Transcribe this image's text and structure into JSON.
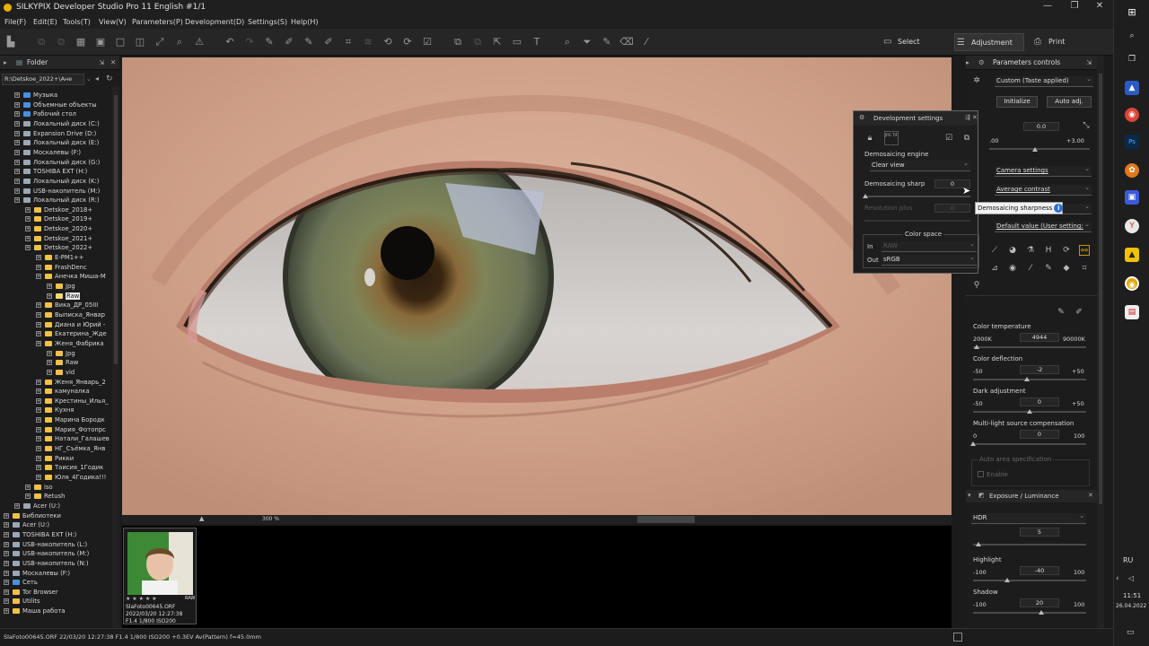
{
  "window": {
    "title": "SILKYPIX Developer Studio Pro 11 English  #1/1"
  },
  "menu": [
    "File(F)",
    "Edit(E)",
    "Tools(T)",
    "View(V)",
    "Parameters(P)",
    "Development(D)",
    "Settings(S)",
    "Help(H)"
  ],
  "modes": {
    "select": "Select",
    "adjustment": "Adjustment",
    "print": "Print"
  },
  "folder_panel": {
    "title": "Folder",
    "path": "R:\\Detskoe_2022+\\Ане",
    "items": [
      {
        "label": "Музыка",
        "indent": 1,
        "icon": "blue"
      },
      {
        "label": "Объемные объекты",
        "indent": 1,
        "icon": "blue"
      },
      {
        "label": "Рабочий стол",
        "indent": 1,
        "icon": "blue"
      },
      {
        "label": "Локальный диск (C:)",
        "indent": 1,
        "icon": "drv"
      },
      {
        "label": "Expansion Drive (D:)",
        "indent": 1,
        "icon": "drv"
      },
      {
        "label": "Локальный диск (E:)",
        "indent": 1,
        "icon": "drv"
      },
      {
        "label": "Москалевы (F:)",
        "indent": 1,
        "icon": "drv"
      },
      {
        "label": "Локальный диск (G:)",
        "indent": 1,
        "icon": "drv"
      },
      {
        "label": "TOSHIBA EXT (H:)",
        "indent": 1,
        "icon": "drv"
      },
      {
        "label": "Локальный диск (K:)",
        "indent": 1,
        "icon": "drv"
      },
      {
        "label": "USB-накопитель (M:)",
        "indent": 1,
        "icon": "drv"
      },
      {
        "label": "Локальный диск (R:)",
        "indent": 1,
        "icon": "drv"
      },
      {
        "label": "Detskoe_2018+",
        "indent": 2,
        "icon": "f"
      },
      {
        "label": "Detskoe_2019+",
        "indent": 2,
        "icon": "f"
      },
      {
        "label": "Detskoe_2020+",
        "indent": 2,
        "icon": "f"
      },
      {
        "label": "Detskoe_2021+",
        "indent": 2,
        "icon": "f"
      },
      {
        "label": "Detskoe_2022+",
        "indent": 2,
        "icon": "f"
      },
      {
        "label": "E-PM1++",
        "indent": 3,
        "icon": "f"
      },
      {
        "label": "FrashDenc",
        "indent": 3,
        "icon": "f"
      },
      {
        "label": "Анечка Миша-М",
        "indent": 3,
        "icon": "f"
      },
      {
        "label": "Jpg",
        "indent": 4,
        "icon": "f"
      },
      {
        "label": "Raw",
        "indent": 4,
        "icon": "sel",
        "selected": true
      },
      {
        "label": "Вика_ДР_05III",
        "indent": 3,
        "icon": "f"
      },
      {
        "label": "Выписка_Январ",
        "indent": 3,
        "icon": "f"
      },
      {
        "label": "Диана и Юрий -",
        "indent": 3,
        "icon": "f"
      },
      {
        "label": "Екатерина_Жде",
        "indent": 3,
        "icon": "f"
      },
      {
        "label": "Женя_Фабрика",
        "indent": 3,
        "icon": "f"
      },
      {
        "label": "Jpg",
        "indent": 4,
        "icon": "f"
      },
      {
        "label": "Raw",
        "indent": 4,
        "icon": "f"
      },
      {
        "label": "vid",
        "indent": 4,
        "icon": "f"
      },
      {
        "label": "Женя_Январь_2",
        "indent": 3,
        "icon": "f"
      },
      {
        "label": "камуналка",
        "indent": 3,
        "icon": "f"
      },
      {
        "label": "Крестины_Илья_",
        "indent": 3,
        "icon": "f"
      },
      {
        "label": "Кухня",
        "indent": 3,
        "icon": "f"
      },
      {
        "label": "Марина Бородк",
        "indent": 3,
        "icon": "f"
      },
      {
        "label": "Мария_Фотопрс",
        "indent": 3,
        "icon": "f"
      },
      {
        "label": "Натали_Галашев",
        "indent": 3,
        "icon": "f"
      },
      {
        "label": "НГ_Съёмка_Янв",
        "indent": 3,
        "icon": "f"
      },
      {
        "label": "Рикки",
        "indent": 3,
        "icon": "f"
      },
      {
        "label": "Таисия_1Годик",
        "indent": 3,
        "icon": "f"
      },
      {
        "label": "Юля_4Годика!!!",
        "indent": 3,
        "icon": "f"
      },
      {
        "label": "iso",
        "indent": 2,
        "icon": "f"
      },
      {
        "label": "Retush",
        "indent": 2,
        "icon": "f"
      },
      {
        "label": "Acer (U:)",
        "indent": 1,
        "icon": "drv"
      },
      {
        "label": "Библиотеки",
        "indent": 0,
        "icon": "f"
      },
      {
        "label": "Acer (U:)",
        "indent": 0,
        "icon": "drv"
      },
      {
        "label": "TOSHIBA EXT (H:)",
        "indent": 0,
        "icon": "drv"
      },
      {
        "label": "USB-накопитель (L:)",
        "indent": 0,
        "icon": "drv"
      },
      {
        "label": "USB-накопитель (M:)",
        "indent": 0,
        "icon": "drv"
      },
      {
        "label": "USB-накопитель (N:)",
        "indent": 0,
        "icon": "drv"
      },
      {
        "label": "Москалевы (F:)",
        "indent": 0,
        "icon": "drv"
      },
      {
        "label": "Сеть",
        "indent": 0,
        "icon": "blue"
      },
      {
        "label": "Tor Browser",
        "indent": 0,
        "icon": "f"
      },
      {
        "label": "Utilits",
        "indent": 0,
        "icon": "f"
      },
      {
        "label": "Маша работа",
        "indent": 0,
        "icon": "f"
      }
    ]
  },
  "viewer": {
    "zoom": "300 %"
  },
  "thumbnail": {
    "filename": "SlaFoto00645.ORF",
    "datetime": "2022/03/20 12:27:38",
    "exposure": "F1.4 1/800 ISO200",
    "badge": "RAW"
  },
  "status_text": "SlaFoto00645.ORF 22/03/20 12:27:38 F1.4 1/800 ISO200 +0.3EV Av(Pattern) f=45.0mm",
  "dev_dialog": {
    "title": "Development settings",
    "demosaicing_engine_label": "Demosaicing engine",
    "demosaicing_engine_value": "Clear view",
    "sharpness_label": "Demosaicing sharp",
    "sharpness_value": "0",
    "resolution_label": "Resolution plus",
    "resolution_value": "0",
    "color_space_label": "Color space",
    "in_label": "In",
    "in_value": "RAW",
    "out_label": "Out",
    "out_value": "sRGB",
    "tooltip": "Demosaicing sharpness"
  },
  "params_panel": {
    "title": "Parameters controls",
    "taste": "Custom (Taste applied)",
    "initialize": "Initialize",
    "auto_adj": "Auto adj.",
    "exposure_value": "0.0",
    "exposure_min": ".00",
    "exposure_max": "+3.00",
    "camera_settings": "Camera settings",
    "contrast": "Average contrast",
    "default_value": "Default value (User setting:",
    "color_temp": {
      "label": "Color temperature",
      "min": "2000K",
      "value": "4944",
      "max": "90000K",
      "fraction": 0.034
    },
    "color_defl": {
      "label": "Color deflection",
      "min": "-50",
      "value": "-2",
      "max": "+50",
      "fraction": 0.48
    },
    "dark_adj": {
      "label": "Dark adjustment",
      "min": "-50",
      "value": "0",
      "max": "+50",
      "fraction": 0.5
    },
    "multi_light": {
      "label": "Multi-light source compensation",
      "min": "0",
      "value": "0",
      "max": "100",
      "fraction": 0.0
    },
    "auto_area": "Auto area specification",
    "enable": "Enable",
    "exposure_section": "Exposure / Luminance",
    "hdr": {
      "label": "HDR",
      "value": "5",
      "fraction": 0.05
    },
    "highlight": {
      "label": "Highlight",
      "min": "-100",
      "value": "-40",
      "max": "100",
      "fraction": 0.3
    },
    "shadow": {
      "label": "Shadow",
      "min": "-100",
      "value": "20",
      "max": "100",
      "fraction": 0.6
    }
  },
  "taskbar": {
    "lang": "RU",
    "time": "11:51",
    "date": "26.04.2022"
  }
}
